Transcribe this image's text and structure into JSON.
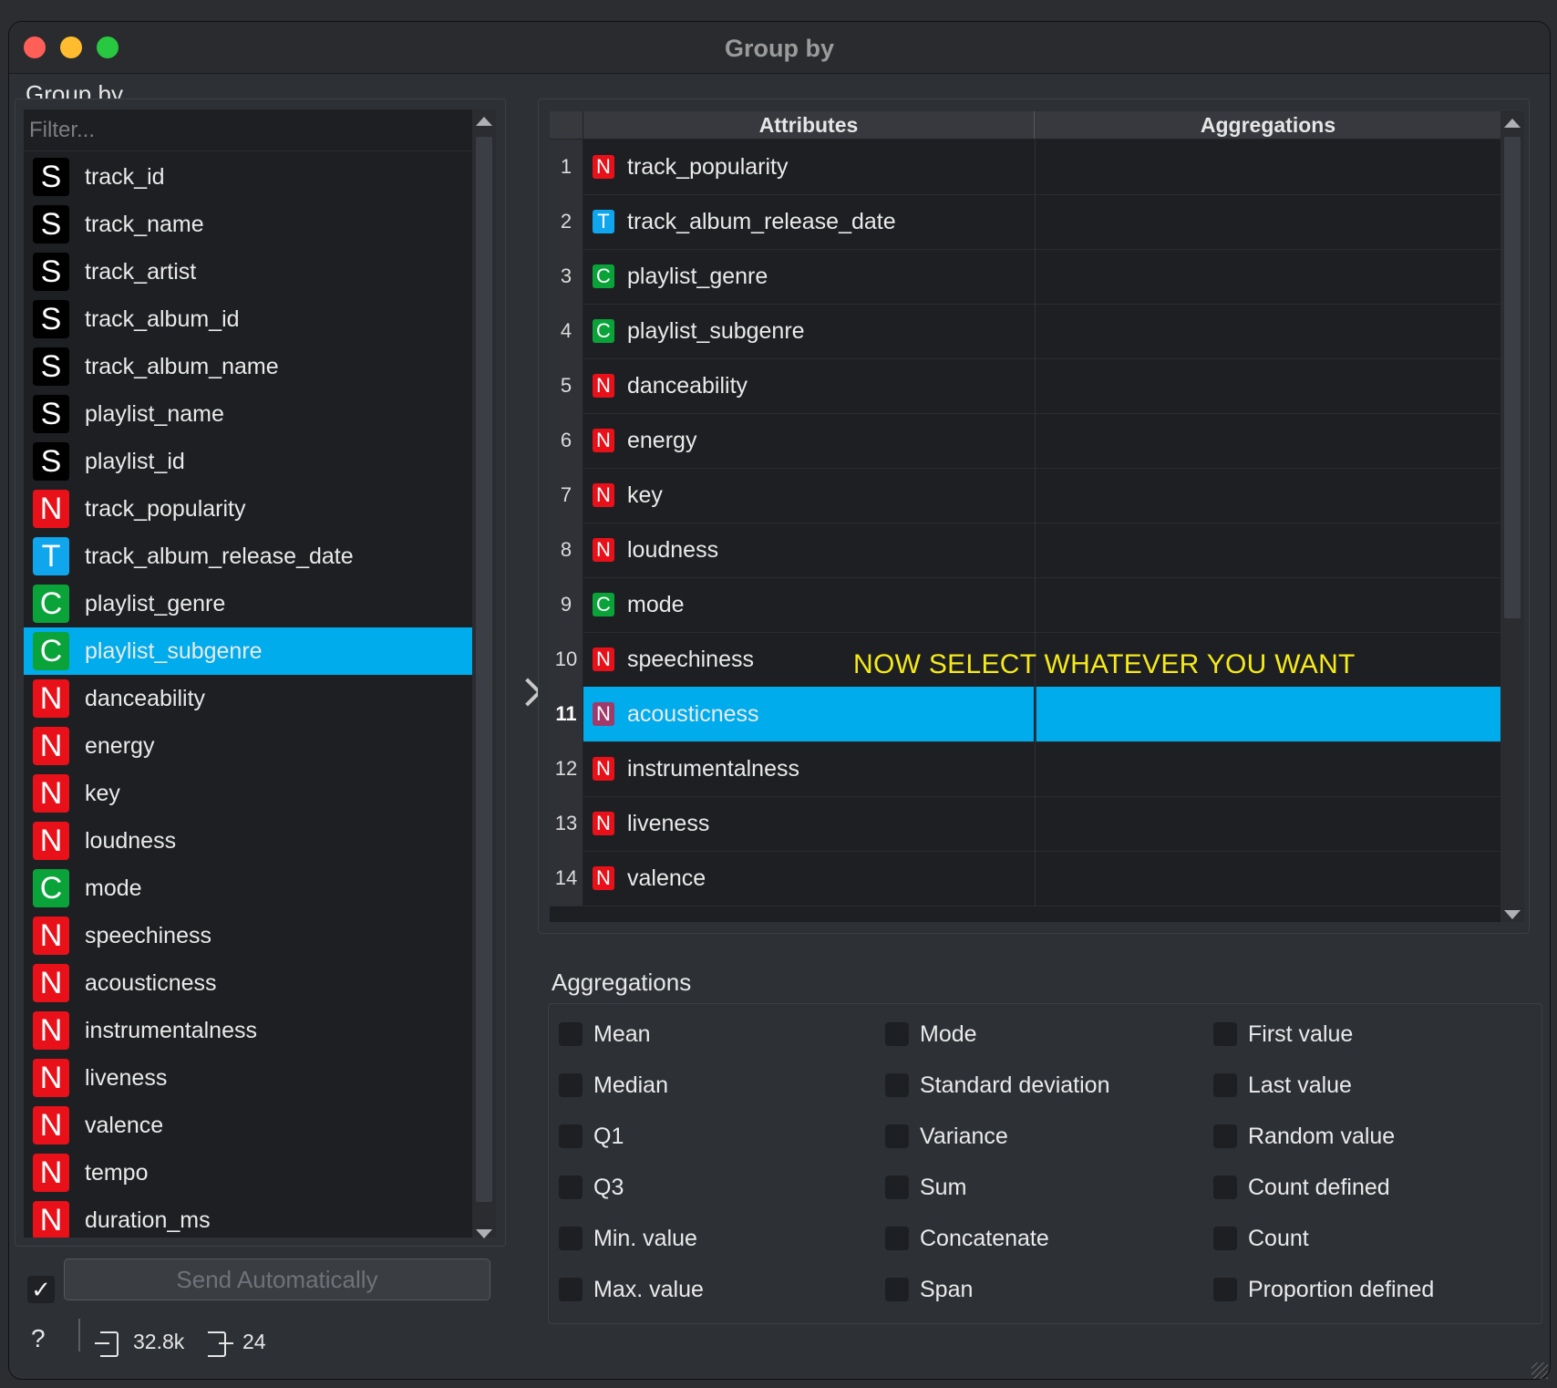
{
  "window": {
    "title": "Group by"
  },
  "sections": {
    "group_by": "Group by",
    "aggregations": "Aggregations"
  },
  "filter": {
    "placeholder": "Filter..."
  },
  "variables": [
    {
      "type": "S",
      "name": "track_id"
    },
    {
      "type": "S",
      "name": "track_name"
    },
    {
      "type": "S",
      "name": "track_artist"
    },
    {
      "type": "S",
      "name": "track_album_id"
    },
    {
      "type": "S",
      "name": "track_album_name"
    },
    {
      "type": "S",
      "name": "playlist_name"
    },
    {
      "type": "S",
      "name": "playlist_id"
    },
    {
      "type": "N",
      "name": "track_popularity"
    },
    {
      "type": "T",
      "name": "track_album_release_date"
    },
    {
      "type": "C",
      "name": "playlist_genre"
    },
    {
      "type": "C",
      "name": "playlist_subgenre",
      "selected": true
    },
    {
      "type": "N",
      "name": "danceability"
    },
    {
      "type": "N",
      "name": "energy"
    },
    {
      "type": "N",
      "name": "key"
    },
    {
      "type": "N",
      "name": "loudness"
    },
    {
      "type": "C",
      "name": "mode"
    },
    {
      "type": "N",
      "name": "speechiness"
    },
    {
      "type": "N",
      "name": "acousticness"
    },
    {
      "type": "N",
      "name": "instrumentalness"
    },
    {
      "type": "N",
      "name": "liveness"
    },
    {
      "type": "N",
      "name": "valence"
    },
    {
      "type": "N",
      "name": "tempo"
    },
    {
      "type": "N",
      "name": "duration_ms"
    }
  ],
  "table": {
    "headers": {
      "attributes": "Attributes",
      "aggregations": "Aggregations"
    },
    "rows": [
      {
        "num": "1",
        "type": "N",
        "name": "track_popularity",
        "agg": ""
      },
      {
        "num": "2",
        "type": "T",
        "name": "track_album_release_date",
        "agg": ""
      },
      {
        "num": "3",
        "type": "C",
        "name": "playlist_genre",
        "agg": ""
      },
      {
        "num": "4",
        "type": "C",
        "name": "playlist_subgenre",
        "agg": ""
      },
      {
        "num": "5",
        "type": "N",
        "name": "danceability",
        "agg": ""
      },
      {
        "num": "6",
        "type": "N",
        "name": "energy",
        "agg": ""
      },
      {
        "num": "7",
        "type": "N",
        "name": "key",
        "agg": ""
      },
      {
        "num": "8",
        "type": "N",
        "name": "loudness",
        "agg": ""
      },
      {
        "num": "9",
        "type": "C",
        "name": "mode",
        "agg": ""
      },
      {
        "num": "10",
        "type": "N",
        "name": "speechiness",
        "agg": ""
      },
      {
        "num": "11",
        "type": "N",
        "name": "acousticness",
        "agg": "",
        "selected": true
      },
      {
        "num": "12",
        "type": "N",
        "name": "instrumentalness",
        "agg": ""
      },
      {
        "num": "13",
        "type": "N",
        "name": "liveness",
        "agg": ""
      },
      {
        "num": "14",
        "type": "N",
        "name": "valence",
        "agg": ""
      }
    ]
  },
  "annotation": "NOW SELECT WHATEVER YOU WANT",
  "aggregation_options": [
    [
      "Mean",
      "Median",
      "Q1",
      "Q3",
      "Min. value",
      "Max. value"
    ],
    [
      "Mode",
      "Standard deviation",
      "Variance",
      "Sum",
      "Concatenate",
      "Span"
    ],
    [
      "First value",
      "Last value",
      "Random value",
      "Count defined",
      "Count",
      "Proportion defined"
    ]
  ],
  "send": {
    "label": "Send Automatically",
    "checked": true,
    "check_glyph": "✓"
  },
  "status": {
    "help": "?",
    "input_count": "32.8k",
    "output_count": "24"
  },
  "colors": {
    "selection": "#00acec",
    "badge_S": "#000000",
    "badge_N": "#e8111a",
    "badge_T": "#10a6ee",
    "badge_C": "#0aa33a",
    "annotation": "#f5ea1a"
  }
}
